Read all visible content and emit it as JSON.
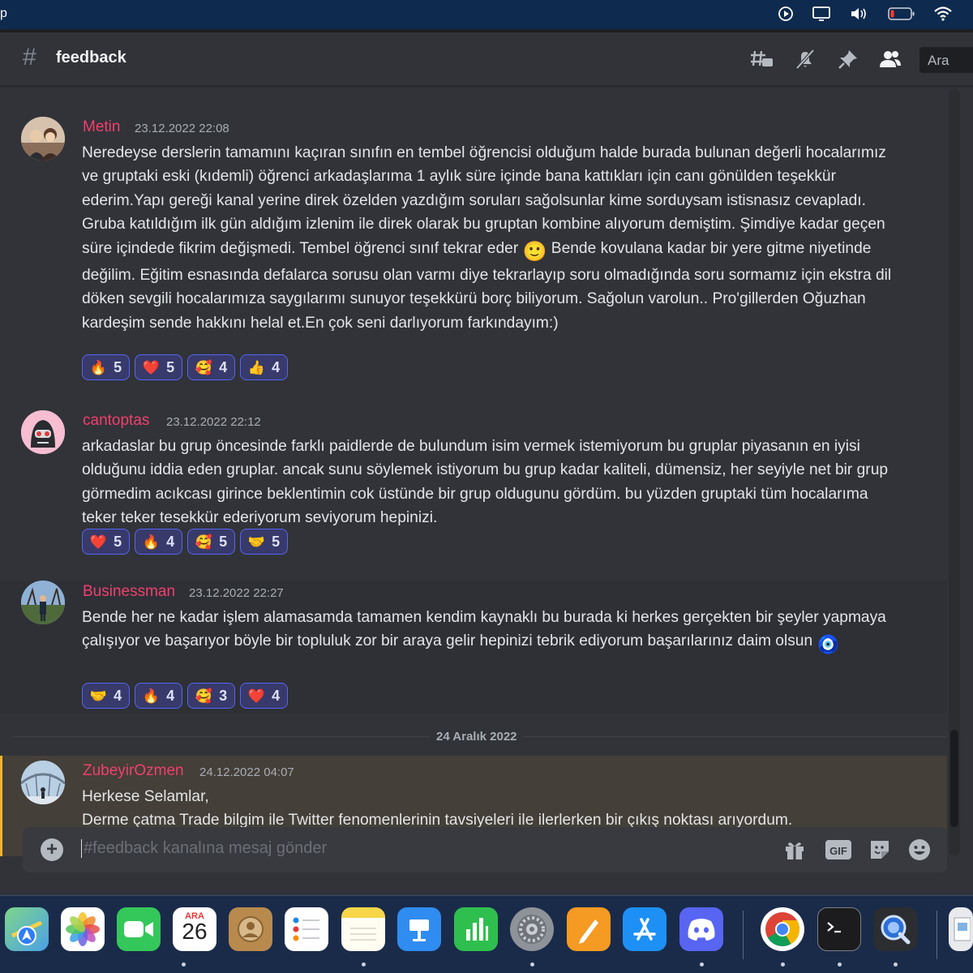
{
  "menubar": {
    "app_glyph": "p",
    "icons": [
      "play-circle-icon",
      "display-icon",
      "volume-icon",
      "battery-icon",
      "wifi-icon"
    ]
  },
  "header": {
    "channel_hash": "#",
    "channel_name": "feedback",
    "search_placeholder": "Ara",
    "icons": [
      "threads-icon",
      "mute-bell-icon",
      "pin-icon",
      "members-icon"
    ]
  },
  "messages": [
    {
      "author": "Metin",
      "timestamp": "23.12.2022 22:08",
      "text_before_emoji": "Neredeyse derslerin tamamını kaçıran sınıfın en tembel öğrencisi olduğum halde burada bulunan değerli hocalarımız ve gruptaki eski (kıdemli) öğrenci arkadaşlarıma 1 aylık süre içinde bana kattıkları için canı gönülden teşekkür ederim.Yapı gereği kanal yerine direk özelden yazdığım soruları sağolsunlar kime sorduysam istisnasız cevapladı. Gruba katıldığım ilk gün aldığım izlenim ile direk olarak bu gruptan kombine alıyorum demiştim. Şimdiye kadar geçen süre içindede  fikrim değişmedi. Tembel öğrenci sınıf tekrar eder ",
      "inline_emoji": "🙂",
      "text_after_emoji": " Bende kovulana kadar bir yere gitme niyetinde değilim. Eğitim esnasında defalarca sorusu olan varmı diye tekrarlayıp soru olmadığında soru sormamız için ekstra dil döken sevgili hocalarımıza saygılarımı sunuyor teşekkürü borç biliyorum. Sağolun varolun.. Pro'gillerden Oğuzhan kardeşim sende hakkını helal et.En çok seni darlıyorum farkındayım:)",
      "reactions": [
        {
          "emoji": "🔥",
          "count": "5"
        },
        {
          "emoji": "❤️",
          "count": "5"
        },
        {
          "emoji": "🥰",
          "count": "4"
        },
        {
          "emoji": "👍",
          "count": "4"
        }
      ]
    },
    {
      "author": "cantoptas",
      "timestamp": "23.12.2022 22:12",
      "text": "arkadaslar bu grup öncesinde farklı paidlerde de bulundum isim vermek istemiyorum bu gruplar piyasanın en iyisi olduğunu iddia eden gruplar. ancak sunu söylemek istiyorum bu grup kadar kaliteli, dümensiz, her seyiyle net bir grup görmedim acıkcası girince beklentimin cok üstünde bir grup oldugunu gördüm. bu yüzden gruptaki tüm hocalarıma teker teker tesekkür ederiyorum seviyorum hepinizi.",
      "reactions": [
        {
          "emoji": "❤️",
          "count": "5"
        },
        {
          "emoji": "🔥",
          "count": "4"
        },
        {
          "emoji": "🥰",
          "count": "5"
        },
        {
          "emoji": "🤝",
          "count": "5"
        }
      ]
    },
    {
      "author": "Businessman",
      "timestamp": "23.12.2022 22:27",
      "text_before_emoji": "Bende her ne kadar işlem alamasamda tamamen kendim kaynaklı bu burada ki herkes gerçekten bir şeyler yapmaya çalışıyor ve başarıyor böyle bir topluluk zor bir araya gelir hepinizi tebrik ediyorum başarılarınız daim olsun ",
      "inline_emoji": "🧿",
      "reactions": [
        {
          "emoji": "🤝",
          "count": "4"
        },
        {
          "emoji": "🔥",
          "count": "4"
        },
        {
          "emoji": "🥰",
          "count": "3"
        },
        {
          "emoji": "❤️",
          "count": "4"
        }
      ]
    },
    {
      "author": "ZubeyirOzmen",
      "timestamp": "24.12.2022 04:07",
      "line1": "Herkese Selamlar,",
      "line2": "Derme çatma Trade bilgim ile Twitter fenomenlerinin tavsiyeleri ile ilerlerken bir çıkış noktası arıyordum."
    }
  ],
  "date_divider": "24 Aralık 2022",
  "composer": {
    "placeholder": "#feedback kanalına mesaj gönder",
    "gif_label": "GIF",
    "icons": [
      "plus-icon",
      "gift-icon",
      "gif-icon",
      "sticker-icon",
      "emoji-icon"
    ]
  },
  "dock": {
    "calendar_month": "ARA",
    "calendar_day": "26",
    "apps": [
      "maps",
      "photos",
      "facetime",
      "calendar",
      "contacts",
      "reminders",
      "notes",
      "keynote",
      "numbers",
      "system-settings",
      "pages",
      "app-store",
      "discord",
      "chrome",
      "terminal",
      "quicktime",
      "preview"
    ]
  },
  "colors": {
    "background": "#313338",
    "username": "#f23f6e",
    "reaction_border": "#5865f2",
    "highlight_bar": "#f0b232",
    "dock": "#1a2b4a"
  }
}
